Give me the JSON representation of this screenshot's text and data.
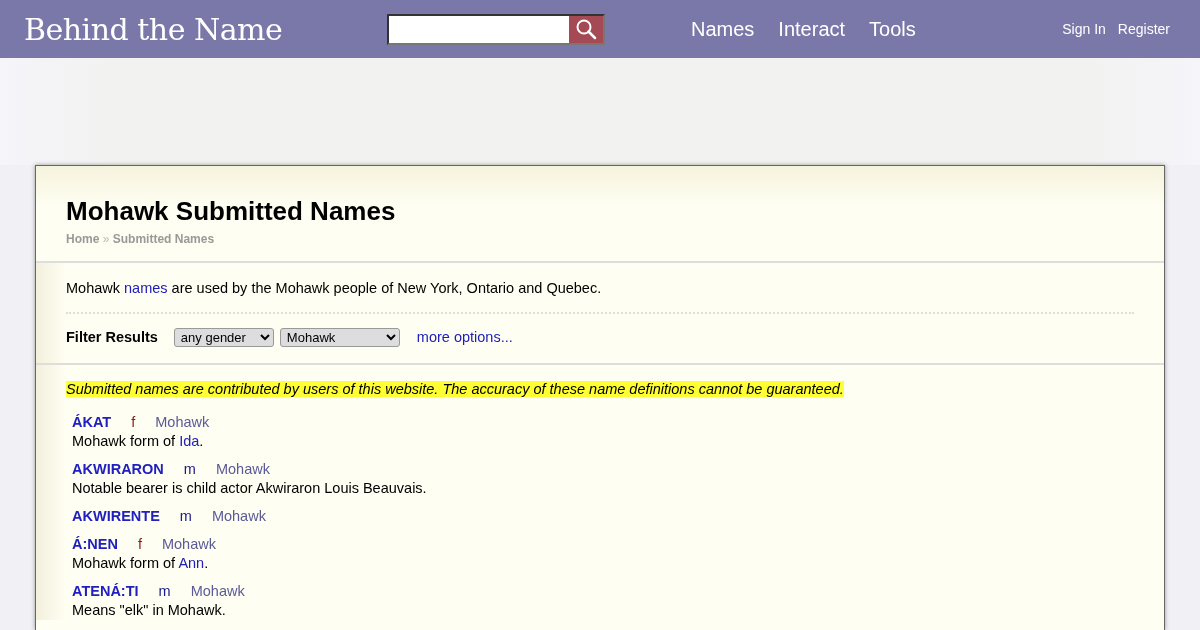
{
  "header": {
    "logo": "Behind the Name",
    "nav": [
      "Names",
      "Interact",
      "Tools"
    ],
    "account": [
      "Sign In",
      "Register"
    ]
  },
  "page": {
    "title": "Mohawk Submitted Names",
    "breadcrumb": [
      "Home",
      "Submitted Names"
    ],
    "breadcrumb_separator": "»",
    "intro": [
      {
        "text": "Mohawk "
      },
      {
        "text": "names",
        "kind": "link"
      },
      {
        "text": " are used by the Mohawk people of New York, Ontario and Quebec."
      }
    ],
    "filter": {
      "label": "Filter Results",
      "gender": "any gender",
      "usage": "Mohawk",
      "more": "more options..."
    },
    "notice": "Submitted names are contributed by users of this website. The accuracy of these name definitions cannot be guaranteed.",
    "names": [
      {
        "name": "ÁKAT",
        "gender": "f",
        "usage": "Mohawk",
        "description": [
          {
            "text": "Mohawk form of "
          },
          {
            "text": "Ida",
            "kind": "link"
          },
          {
            "text": "."
          }
        ]
      },
      {
        "name": "AKWIRARON",
        "gender": "m",
        "usage": "Mohawk",
        "description": [
          {
            "text": "Notable bearer is child actor Akwiraron Louis Beauvais."
          }
        ]
      },
      {
        "name": "AKWIRENTE",
        "gender": "m",
        "usage": "Mohawk"
      },
      {
        "name": "Á:NEN",
        "gender": "f",
        "usage": "Mohawk",
        "description": [
          {
            "text": "Mohawk form of "
          },
          {
            "text": "Ann",
            "kind": "link"
          },
          {
            "text": "."
          }
        ]
      },
      {
        "name": "ATENÁ:TI",
        "gender": "m",
        "usage": "Mohawk",
        "description": [
          {
            "text": "Means \"elk\" in Mohawk."
          }
        ]
      }
    ]
  }
}
